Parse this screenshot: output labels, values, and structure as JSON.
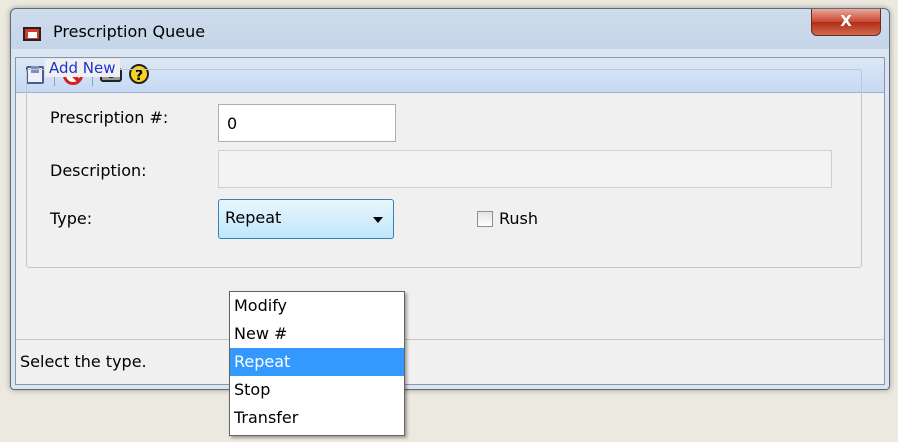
{
  "window": {
    "title": "Prescription Queue",
    "close_glyph": "X"
  },
  "toolbar": {
    "items": [
      {
        "icon": "save-icon"
      },
      {
        "icon": "cancel-icon"
      },
      {
        "icon": "money-icon"
      },
      {
        "icon": "help-icon",
        "glyph": "?"
      }
    ]
  },
  "form": {
    "group_title": "Add New",
    "prescription_label": "Prescription #:",
    "prescription_value": "0",
    "description_label": "Description:",
    "description_value": "",
    "type_label": "Type:",
    "type_value": "Repeat",
    "rush_label": "Rush",
    "rush_checked": false
  },
  "status": {
    "text": "Select the type."
  },
  "dropdown": {
    "options": [
      "Modify",
      "New #",
      "Repeat",
      "Stop",
      "Transfer"
    ],
    "selected": "Repeat"
  },
  "colors": {
    "group_title": "#1a33d0",
    "selection": "#3399ff",
    "toolbar": "#c6d9f3"
  }
}
